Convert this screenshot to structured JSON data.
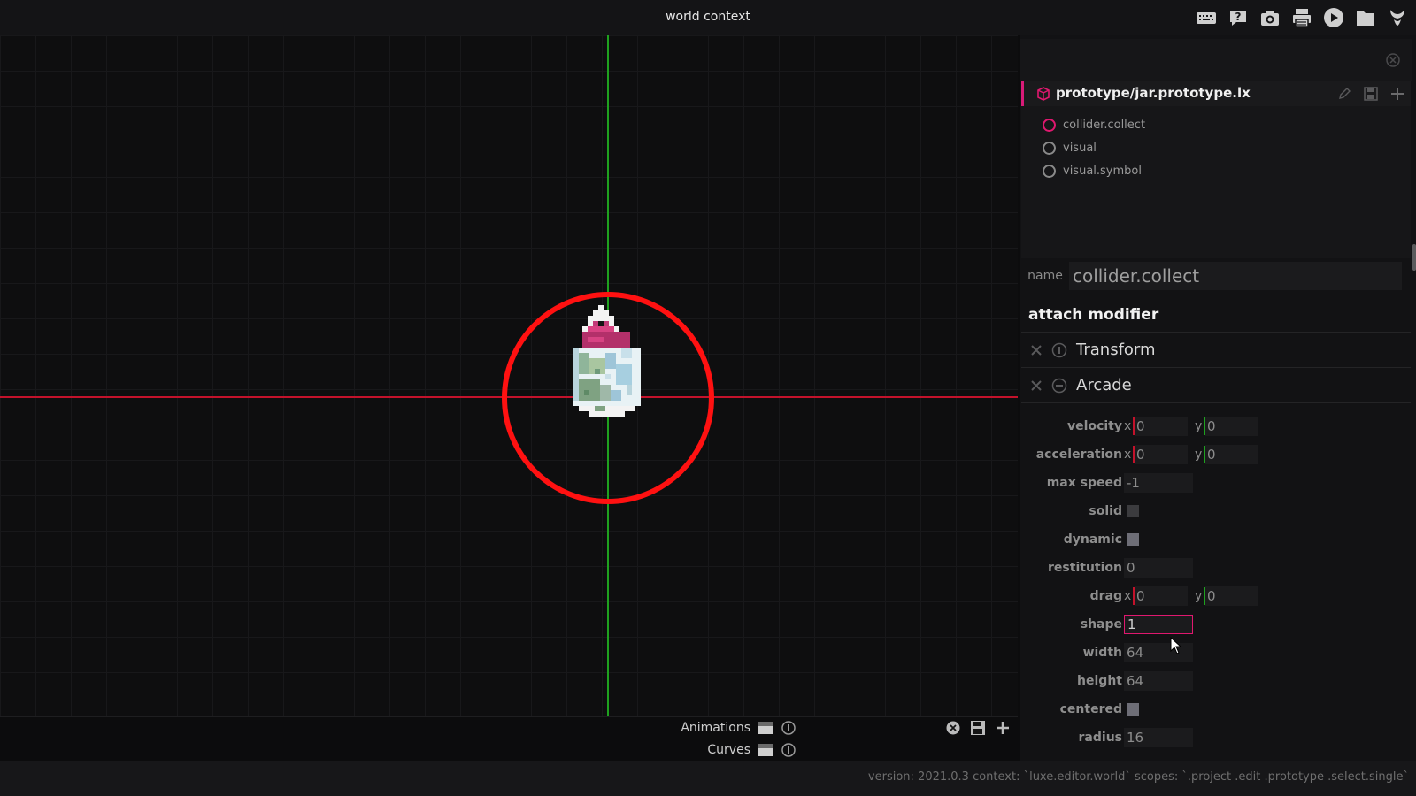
{
  "window": {
    "title": "world context"
  },
  "toolbar": {
    "icons": [
      "keyboard-icon",
      "help-icon",
      "camera-icon",
      "printer-icon",
      "play-icon",
      "folder-icon",
      "logo-icon"
    ]
  },
  "timeline": {
    "animations_label": "Animations",
    "curves_label": "Curves"
  },
  "status": {
    "text": "version: 2021.0.3 context: `luxe.editor.world` scopes: `.project .edit .prototype .select.single`"
  },
  "panel": {
    "prototype_title": "prototype/jar.prototype.lx",
    "components": [
      {
        "label": "collider.collect",
        "active": true
      },
      {
        "label": "visual",
        "active": false
      },
      {
        "label": "visual.symbol",
        "active": false
      }
    ],
    "name_label": "name",
    "name_value": "collider.collect",
    "attach_label": "attach modifier",
    "modifiers": [
      "Transform",
      "Arcade"
    ],
    "props": {
      "velocity": {
        "label": "velocity",
        "x": "0",
        "y": "0"
      },
      "acceleration": {
        "label": "acceleration",
        "x": "0",
        "y": "0"
      },
      "max_speed": {
        "label": "max speed",
        "value": "-1"
      },
      "solid": {
        "label": "solid",
        "checked": false
      },
      "dynamic": {
        "label": "dynamic",
        "checked": true
      },
      "restitution": {
        "label": "restitution",
        "value": "0"
      },
      "drag": {
        "label": "drag",
        "x": "0",
        "y": "0"
      },
      "shape": {
        "label": "shape",
        "value": "1"
      },
      "width": {
        "label": "width",
        "value": "64"
      },
      "height": {
        "label": "height",
        "value": "64"
      },
      "centered": {
        "label": "centered",
        "checked": true
      },
      "radius": {
        "label": "radius",
        "value": "16"
      }
    },
    "axis_labels": {
      "x": "x",
      "y": "y"
    }
  },
  "colors": {
    "accent": "#e0186f",
    "axis_x": "#c3122b",
    "axis_y": "#1fa11f",
    "collider": "#ff1111"
  }
}
